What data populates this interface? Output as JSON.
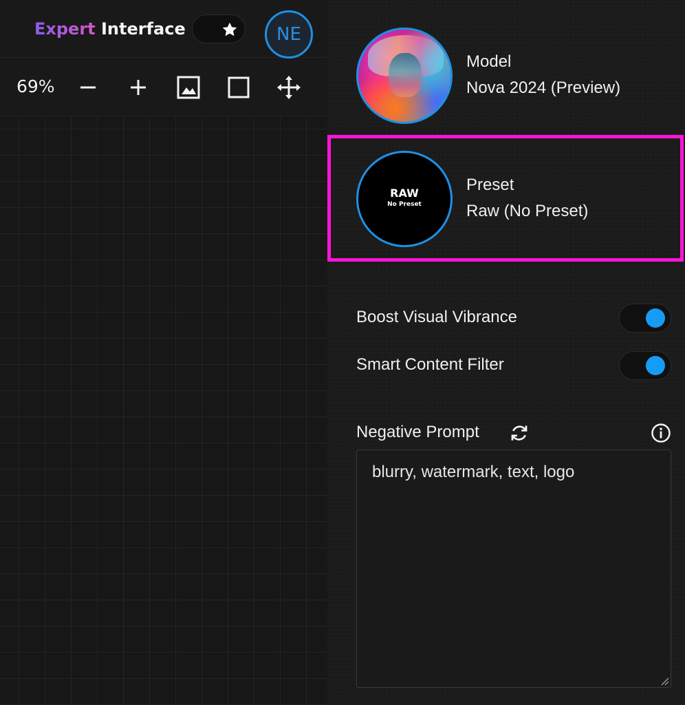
{
  "header": {
    "brand_part1": "Expert",
    "brand_part2": "Interface",
    "avatar_initials": "NE"
  },
  "toolbar": {
    "zoom": "69%",
    "tools": [
      "zoom-out",
      "zoom-in",
      "image",
      "frame",
      "move"
    ]
  },
  "model": {
    "label": "Model",
    "name": "Nova 2024 (Preview)"
  },
  "preset": {
    "label": "Preset",
    "name": "Raw (No Preset)",
    "thumb_title": "RAW",
    "thumb_subtitle": "No Preset"
  },
  "settings": {
    "boost_label": "Boost Visual Vibrance",
    "boost_on": true,
    "filter_label": "Smart Content Filter",
    "filter_on": true
  },
  "negative_prompt": {
    "label": "Negative Prompt",
    "value": "blurry, watermark, text, logo"
  },
  "colors": {
    "accent": "#169cf5",
    "highlight": "#ff14d8",
    "brand_gradient_start": "#8e5cf0",
    "brand_gradient_end": "#d457c8"
  }
}
